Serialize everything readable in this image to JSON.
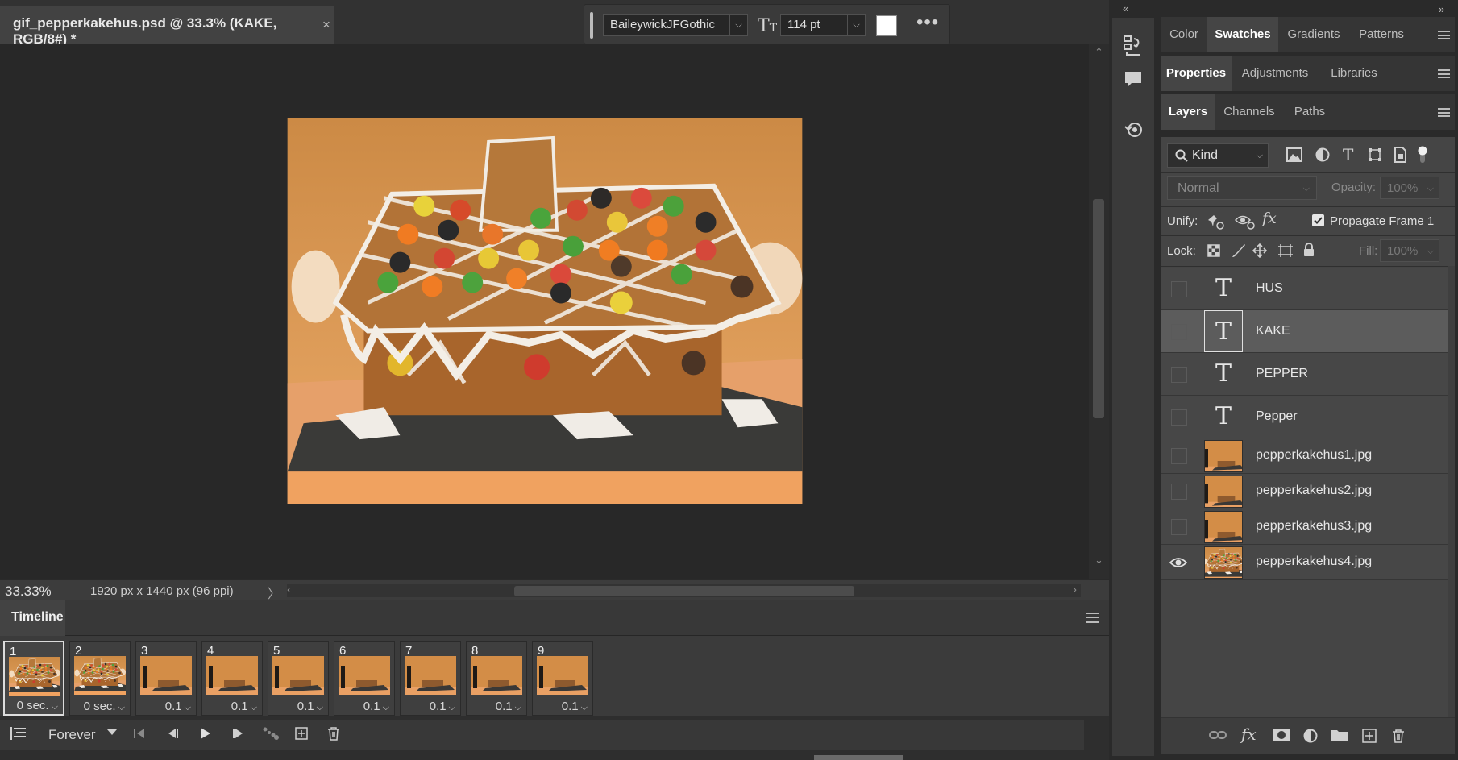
{
  "document": {
    "tab_title": "gif_pepperkakehus.psd @ 33.3% (KAKE, RGB/8#) *",
    "close": "×"
  },
  "text_toolbar": {
    "font_family": "BaileywickJFGothic",
    "font_size": "114 pt",
    "text_color": "#ffffff",
    "more": "•••"
  },
  "status": {
    "zoom": "33.33%",
    "doc_size": "1920 px x 1440 px (96 ppi)",
    "arrow": "〉"
  },
  "timeline": {
    "tab": "Timeline",
    "loop": "Forever",
    "frames": [
      {
        "num": "1",
        "delay": "0 sec.",
        "selected": true
      },
      {
        "num": "2",
        "delay": "0 sec.",
        "selected": false
      },
      {
        "num": "3",
        "delay": "0.1",
        "selected": false
      },
      {
        "num": "4",
        "delay": "0.1",
        "selected": false
      },
      {
        "num": "5",
        "delay": "0.1",
        "selected": false
      },
      {
        "num": "6",
        "delay": "0.1",
        "selected": false
      },
      {
        "num": "7",
        "delay": "0.1",
        "selected": false
      },
      {
        "num": "8",
        "delay": "0.1",
        "selected": false
      },
      {
        "num": "9",
        "delay": "0.1",
        "selected": false
      }
    ]
  },
  "panels": {
    "group1": [
      "Color",
      "Swatches",
      "Gradients",
      "Patterns"
    ],
    "group1_active": "Swatches",
    "group2": [
      "Properties",
      "Adjustments",
      "Libraries"
    ],
    "group2_active": "Properties",
    "group3": [
      "Layers",
      "Channels",
      "Paths"
    ],
    "group3_active": "Layers"
  },
  "layers_panel": {
    "filter": "Kind",
    "blend_mode": "Normal",
    "opacity_label": "Opacity:",
    "opacity_value": "100%",
    "unify_label": "Unify:",
    "propagate_label": "Propagate Frame 1",
    "lock_label": "Lock:",
    "fill_label": "Fill:",
    "fill_value": "100%",
    "layers": [
      {
        "name": "HUS",
        "type": "text",
        "visible": false,
        "selected": false
      },
      {
        "name": "KAKE",
        "type": "text",
        "visible": false,
        "selected": true
      },
      {
        "name": "PEPPER",
        "type": "text",
        "visible": false,
        "selected": false
      },
      {
        "name": "Pepper",
        "type": "text",
        "visible": false,
        "selected": false
      },
      {
        "name": "pepperkakehus1.jpg",
        "type": "image",
        "visible": false,
        "selected": false
      },
      {
        "name": "pepperkakehus2.jpg",
        "type": "image",
        "visible": false,
        "selected": false
      },
      {
        "name": "pepperkakehus3.jpg",
        "type": "image",
        "visible": false,
        "selected": false
      },
      {
        "name": "pepperkakehus4.jpg",
        "type": "image",
        "visible": true,
        "selected": false
      }
    ]
  },
  "colors": {
    "accent_selected": "#5c5c5c",
    "canvas_bg": "#282828",
    "photo_wall": "#d9934e"
  }
}
